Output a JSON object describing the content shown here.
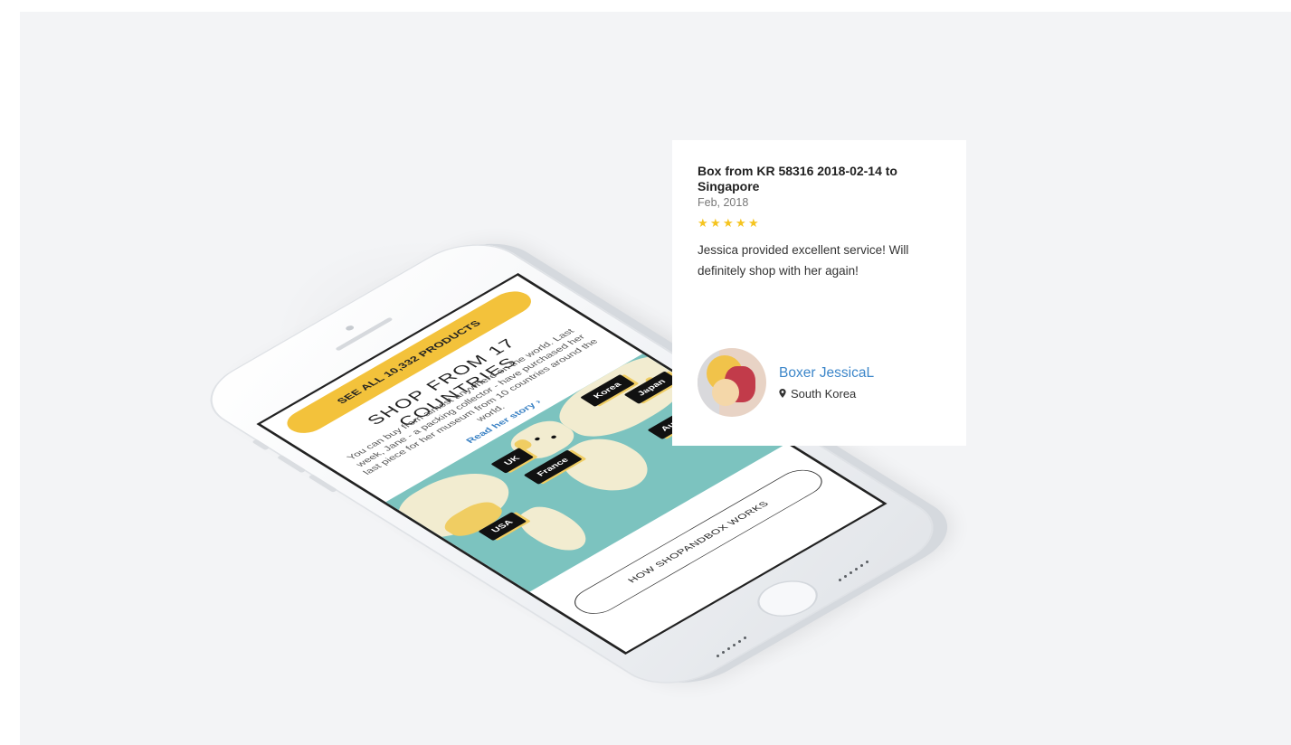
{
  "phone": {
    "cta_label": "SEE ALL 10,332 PRODUCTS",
    "shop_title": "SHOP FROM 17 COUNTRIES",
    "shop_description": "You can buy from almost anywhere on the world. Last week, Jane - a packing collector - have purchased her last piece for her museum from 10 countries around the world.",
    "read_story_label": "Read her story ›",
    "map_pins": [
      "Korea",
      "Japan",
      "Australia",
      "UK",
      "France",
      "USA"
    ],
    "how_button_label": "HOW SHOPANDBOX WORKS"
  },
  "review": {
    "title": "Box from KR 58316 2018-02-14 to Singapore",
    "date": "Feb, 2018",
    "rating": 5,
    "stars": [
      "★",
      "★",
      "★",
      "★",
      "★"
    ],
    "text": "Jessica provided excellent service! Will definitely shop with her again!",
    "reviewer_name": "Boxer JessicaL",
    "reviewer_location": "South Korea"
  },
  "colors": {
    "accent_yellow": "#f3c23b",
    "link_blue": "#3c86c9",
    "map_sea": "#7cc3bf",
    "map_land": "#f2ecd0",
    "star": "#f5c41f"
  },
  "icons": {
    "location": "map-marker-icon",
    "star": "star-icon"
  }
}
